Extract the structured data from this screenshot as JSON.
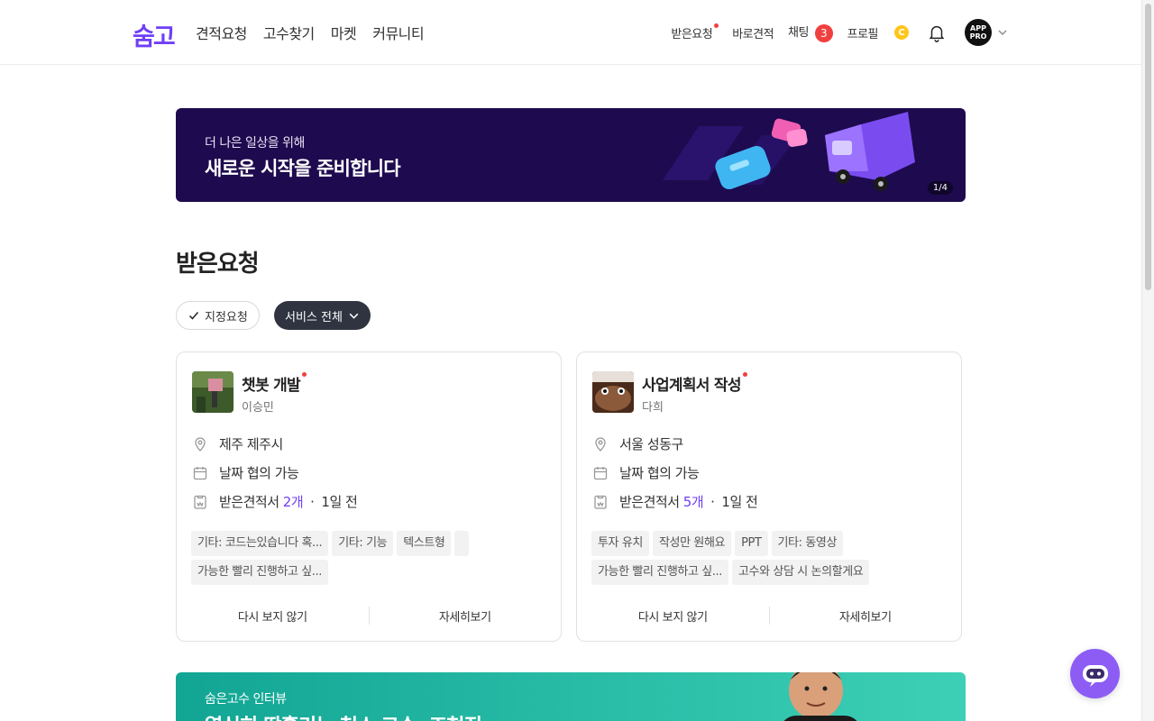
{
  "header": {
    "logo": "숨고",
    "nav_left": [
      "견적요청",
      "고수찾기",
      "마켓",
      "커뮤니티"
    ],
    "nav_right": {
      "received_requests": "받은요청",
      "quick_quote": "바로견적",
      "chat": "채팅",
      "chat_count": "3",
      "profile": "프로필",
      "coin": "C",
      "avatar_text_line1": "APP",
      "avatar_text_line2": "PRO"
    }
  },
  "banner": {
    "subtitle": "더 나은 일상을 위해",
    "title": "새로운 시작을 준비합니다",
    "counter": "1/4"
  },
  "section_title": "받은요청",
  "filters": {
    "assigned": "지정요청",
    "service": "서비스 전체"
  },
  "cards": [
    {
      "title": "챗봇 개발",
      "name": "이승민",
      "location": "제주 제주시",
      "date": "날짜 협의 가능",
      "quotes_prefix": "받은견적서 ",
      "quotes_count": "2개",
      "time": "1일 전",
      "tags": [
        "기타: 코드는있습니다 혹...",
        "기타: 기능",
        "텍스트형",
        "",
        "가능한 빨리 진행하고 싶..."
      ],
      "hide_label": "다시 보지 않기",
      "detail_label": "자세히보기"
    },
    {
      "title": "사업계획서 작성",
      "name": "다희",
      "location": "서울 성동구",
      "date": "날짜 협의 가능",
      "quotes_prefix": "받은견적서 ",
      "quotes_count": "5개",
      "time": "1일 전",
      "tags": [
        "투자 유치",
        "작성만 원해요",
        "PPT",
        "기타: 동영상",
        "가능한 빨리 진행하고 싶...",
        "고수와 상담 시 논의할게요"
      ],
      "hide_label": "다시 보지 않기",
      "detail_label": "자세히보기"
    }
  ],
  "bottom_banner": {
    "subtitle": "숨은고수 인터뷰",
    "title": "열심히 땀흘리는 청소 고수, 조현진"
  },
  "colors": {
    "brand": "#6f3ff5",
    "badge": "#f13f3f",
    "banner_bg": "#1e0a4e",
    "filter_active": "#2f3440",
    "bot": "#8d5cf5"
  }
}
